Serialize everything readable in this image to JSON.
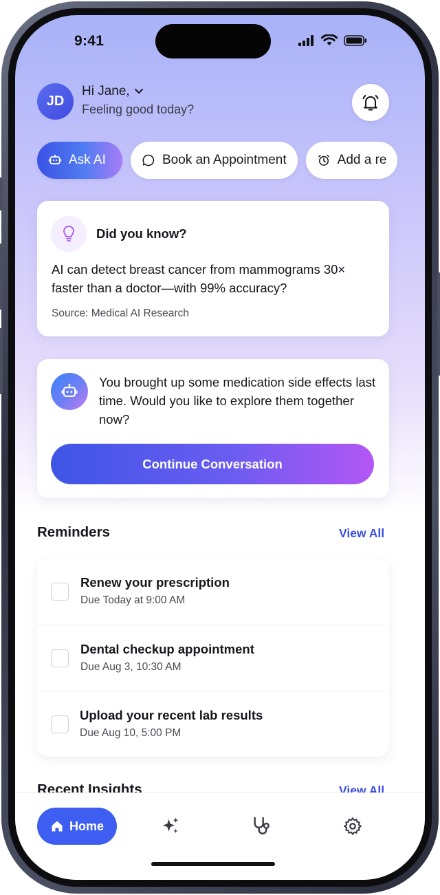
{
  "status_bar": {
    "time": "9:41"
  },
  "header": {
    "avatar_initials": "JD",
    "greeting": "Hi Jane,",
    "subgreeting": "Feeling good today?"
  },
  "quick_actions": [
    {
      "label": "Ask AI",
      "icon": "ai-chat-icon"
    },
    {
      "label": "Book an Appointment",
      "icon": "chat-bubble-icon"
    },
    {
      "label": "Add a re",
      "icon": "alarm-clock-icon"
    }
  ],
  "did_you_know": {
    "title": "Did you know?",
    "body": "AI can detect breast cancer from mammograms 30× faster than a doctor—with 99% accuracy?",
    "source": "Source: Medical AI Research"
  },
  "conversation": {
    "message": "You brought up some medication side effects last time. Would you like to explore them together now?",
    "button_label": "Continue Conversation"
  },
  "reminders": {
    "title": "Reminders",
    "view_all": "View All",
    "items": [
      {
        "title": "Renew your prescription",
        "due": "Due Today at 9:00 AM",
        "checked": false
      },
      {
        "title": "Dental checkup appointment",
        "due": "Due Aug 3, 10:30 AM",
        "checked": false
      },
      {
        "title": "Upload your recent lab results",
        "due": "Due Aug 10, 5:00 PM",
        "checked": false
      }
    ]
  },
  "recent_insights": {
    "title": "Recent Insights",
    "view_all": "View All"
  },
  "bottom_nav": {
    "home_label": "Home",
    "items": [
      "home-icon",
      "sparkles-icon",
      "stethoscope-icon",
      "settings-icon"
    ]
  },
  "colors": {
    "primary": "#3d5ef0",
    "accent_purple": "#b457f5",
    "link": "#3a4fe0"
  }
}
